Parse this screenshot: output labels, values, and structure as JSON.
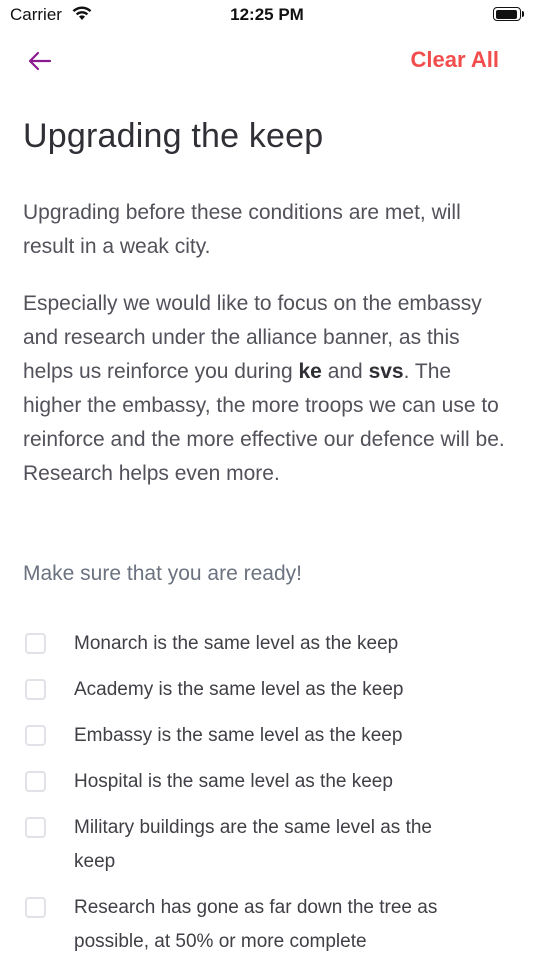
{
  "status_bar": {
    "carrier": "Carrier",
    "time": "12:25 PM"
  },
  "nav": {
    "clear_label": "Clear All"
  },
  "title": "Upgrading the keep",
  "intro": "Upgrading before these conditions are met, will result in a weak city.",
  "body": {
    "part1": "Especially we would like to focus on the embassy and research under the alliance banner, as this helps us reinforce you during ",
    "bold1": "ke",
    "part2": " and ",
    "bold2": "svs",
    "part3": ". The higher the embassy, the more troops we can use to reinforce and the more effective our defence will be. Research helps even more."
  },
  "checklist_heading": "Make sure that you are ready!",
  "checklist": [
    {
      "label": "Monarch is the same level as the keep",
      "checked": false
    },
    {
      "label": "Academy is the same level as the keep",
      "checked": false
    },
    {
      "label": "Embassy is the same level as the keep",
      "checked": false
    },
    {
      "label": "Hospital is the same level as the keep",
      "checked": false
    },
    {
      "label": "Military buildings are the same level as the keep",
      "checked": false
    },
    {
      "label": "Research has gone as far down the tree as possible, at 50% or more complete",
      "checked": false
    }
  ],
  "colors": {
    "accent": "#8b1a8f",
    "danger": "#f24d4d",
    "checkbox_border": "#e0e2e7"
  },
  "icons": {
    "back": "arrow-left-icon",
    "wifi": "wifi-icon",
    "battery": "battery-icon"
  }
}
